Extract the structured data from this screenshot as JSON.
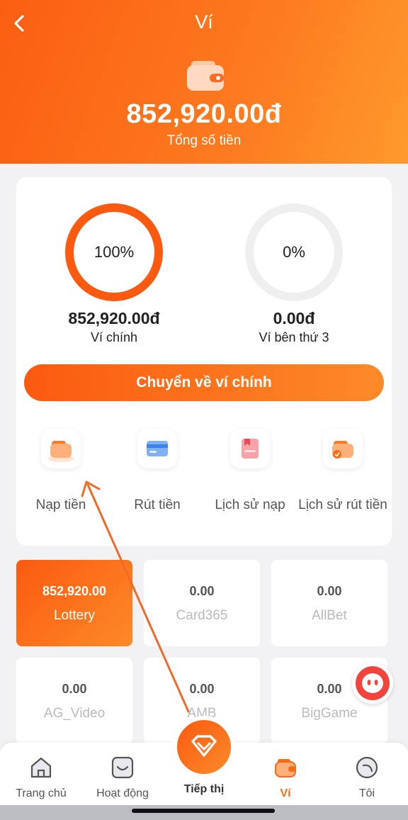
{
  "header": {
    "title": "Ví",
    "total_amount": "852,920.00đ",
    "total_label": "Tổng số tiền",
    "colors": {
      "accent": "#fb5e12",
      "accent_light": "#fe9a2d"
    }
  },
  "wallets": {
    "main": {
      "percent": "100%",
      "amount": "852,920.00đ",
      "label": "Ví chính",
      "fill": 1.0
    },
    "third_party": {
      "percent": "0%",
      "amount": "0.00đ",
      "label": "Ví bên thứ 3",
      "fill": 0.0
    }
  },
  "transfer_button": "Chuyển về ví chính",
  "actions": [
    {
      "label": "Nạp tiền",
      "icon": "deposit-wallet-icon"
    },
    {
      "label": "Rút tiền",
      "icon": "withdraw-card-icon"
    },
    {
      "label": "Lịch sử nạp",
      "icon": "deposit-history-icon"
    },
    {
      "label": "Lịch sử rút tiền",
      "icon": "withdraw-history-icon"
    }
  ],
  "game_wallets": [
    {
      "amount": "852,920.00",
      "name": "Lottery",
      "active": true
    },
    {
      "amount": "0.00",
      "name": "Card365",
      "active": false
    },
    {
      "amount": "0.00",
      "name": "AllBet",
      "active": false
    },
    {
      "amount": "0.00",
      "name": "AG_Video",
      "active": false
    },
    {
      "amount": "0.00",
      "name": "AMB",
      "active": false
    },
    {
      "amount": "0.00",
      "name": "BigGame",
      "active": false
    }
  ],
  "nav": [
    {
      "label": "Trang chủ",
      "icon": "home-icon"
    },
    {
      "label": "Hoạt động",
      "icon": "activity-icon"
    },
    {
      "label": "Tiếp thị",
      "icon": "diamond-icon"
    },
    {
      "label": "Ví",
      "icon": "wallet-icon",
      "active": true
    },
    {
      "label": "Tôi",
      "icon": "profile-icon"
    }
  ]
}
